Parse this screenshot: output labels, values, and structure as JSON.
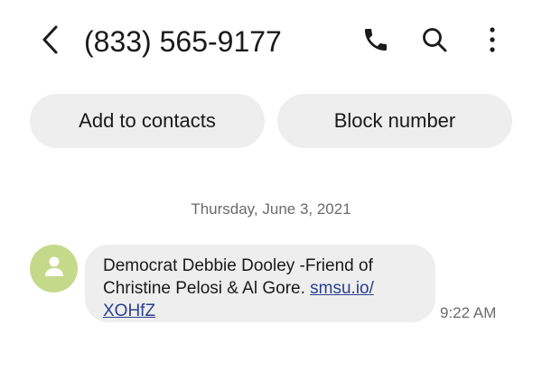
{
  "header": {
    "phone_number": "(833) 565-9177",
    "icons": {
      "back": "chevron-left-icon",
      "call": "phone-icon",
      "search": "search-icon",
      "more": "more-vertical-icon"
    }
  },
  "actions": {
    "add_to_contacts": "Add to contacts",
    "block_number": "Block number"
  },
  "conversation": {
    "date_separator": "Thursday, June 3, 2021",
    "messages": [
      {
        "text_line1": "Democrat Debbie Dooley -Friend of",
        "text_line2_prefix": "Christine Pelosi & Al Gore. ",
        "link_part1": "smsu.io/",
        "link_part2": "XOHfZ",
        "time": "9:22 AM"
      }
    ]
  },
  "colors": {
    "background": "#ffffff",
    "pill_background": "#eeeeee",
    "avatar_background": "#c5d98a",
    "link": "#2a3f8f",
    "secondary_text": "#6b6b6b"
  }
}
